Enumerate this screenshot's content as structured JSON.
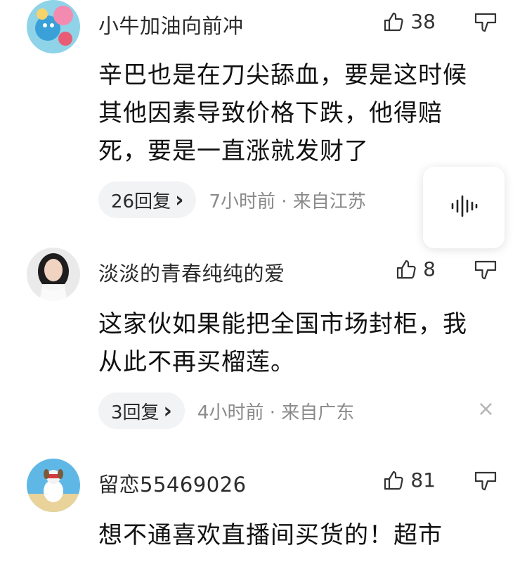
{
  "comments": [
    {
      "username": "小牛加油向前冲",
      "likes": "38",
      "text_lines": [
        "辛巴也是在刀尖舔血，要是这时候",
        "其他因素导致价格下跌，他得赔",
        "死，要是一直涨就发财了"
      ],
      "reply_label": "26回复",
      "meta": "7小时前 · 来自江苏"
    },
    {
      "username": "淡淡的青春纯纯的爱",
      "likes": "8",
      "text_lines": [
        "这家伙如果能把全国市场封柜，我",
        "从此不再买榴莲。"
      ],
      "reply_label": "3回复",
      "meta": "4小时前 · 来自广东"
    },
    {
      "username": "留恋55469026",
      "likes": "81",
      "text_lines": [
        "想不通喜欢直播间买货的！超市"
      ]
    }
  ],
  "close_glyph": "×",
  "chevron_glyph": "›",
  "colors": {
    "reply_bg": "#f2f3f5",
    "meta_text": "#8a8a8a",
    "body_text": "#111111"
  },
  "icons": [
    "thumbs-up-icon",
    "thumbs-down-icon",
    "voice-wave-icon",
    "chevron-right-icon",
    "close-icon"
  ]
}
